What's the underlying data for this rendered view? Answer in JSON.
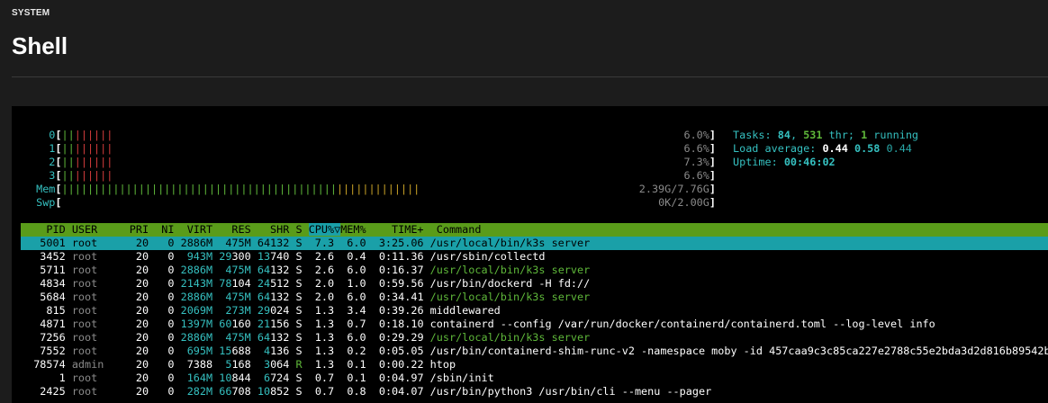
{
  "page": {
    "section_label": "SYSTEM",
    "title": "Shell"
  },
  "meters": [
    {
      "label": "0",
      "bars_green": "||",
      "bars_red": "||||||",
      "value": "6.0%"
    },
    {
      "label": "1",
      "bars_green": "||",
      "bars_red": "||||||",
      "value": "6.6%"
    },
    {
      "label": "2",
      "bars_green": "||",
      "bars_red": "||||||",
      "value": "7.3%"
    },
    {
      "label": "3",
      "bars_green": "||",
      "bars_red": "||||||",
      "value": "6.6%"
    },
    {
      "label": "Mem",
      "bars_green": "|||||||||||||||||||||||||||||||||||||||||||",
      "bars_red": "",
      "bars_yellow": "|||||||||||||",
      "value": "2.39G/7.76G"
    },
    {
      "label": "Swp",
      "bars_green": "",
      "bars_red": "",
      "value": "0K/2.00G"
    }
  ],
  "stats": {
    "tasks_label": "Tasks: ",
    "tasks": "84",
    "sep": ", ",
    "threads": "531",
    "thr_label": " thr; ",
    "running": "1",
    "running_label": " running",
    "load_label": "Load average: ",
    "load1": "0.44",
    "load5": "0.58",
    "load15": "0.44",
    "uptime_label": "Uptime: ",
    "uptime": "00:46:02"
  },
  "columns": {
    "pid": "PID",
    "user": "USER",
    "pri": "PRI",
    "ni": "NI",
    "virt": "VIRT",
    "res": "RES",
    "shr": "SHR",
    "s": "S",
    "cpu": "CPU%",
    "sort_arrow": "▽",
    "mem": "MEM%",
    "time": "TIME+",
    "command": "Command"
  },
  "processes": [
    {
      "pid": "5001",
      "user": "root",
      "pri": "20",
      "ni": "0",
      "virt": "2886M",
      "res": "475M",
      "shr": "64132",
      "s": "S",
      "cpu": "7.3",
      "mem": "6.0",
      "time": "3:25.06",
      "command": "/usr/local/bin/k3s server",
      "selected": true,
      "thread": true
    },
    {
      "pid": "3452",
      "user": "root",
      "pri": "20",
      "ni": "0",
      "virt": "943M",
      "res": "29300",
      "shr": "13740",
      "s": "S",
      "cpu": "2.6",
      "mem": "0.4",
      "time": "0:11.36",
      "command": "/usr/sbin/collectd",
      "thread": false
    },
    {
      "pid": "5711",
      "user": "root",
      "pri": "20",
      "ni": "0",
      "virt": "2886M",
      "res": "475M",
      "shr": "64132",
      "s": "S",
      "cpu": "2.6",
      "mem": "6.0",
      "time": "0:16.37",
      "command": "/usr/local/bin/k3s server",
      "thread": true
    },
    {
      "pid": "4834",
      "user": "root",
      "pri": "20",
      "ni": "0",
      "virt": "2143M",
      "res": "78104",
      "shr": "24512",
      "s": "S",
      "cpu": "2.0",
      "mem": "1.0",
      "time": "0:59.56",
      "command": "/usr/bin/dockerd -H fd://",
      "thread": false
    },
    {
      "pid": "5684",
      "user": "root",
      "pri": "20",
      "ni": "0",
      "virt": "2886M",
      "res": "475M",
      "shr": "64132",
      "s": "S",
      "cpu": "2.0",
      "mem": "6.0",
      "time": "0:34.41",
      "command": "/usr/local/bin/k3s server",
      "thread": true
    },
    {
      "pid": "815",
      "user": "root",
      "pri": "20",
      "ni": "0",
      "virt": "2069M",
      "res": "273M",
      "shr": "29024",
      "s": "S",
      "cpu": "1.3",
      "mem": "3.4",
      "time": "0:39.26",
      "command": "middlewared",
      "thread": false
    },
    {
      "pid": "4871",
      "user": "root",
      "pri": "20",
      "ni": "0",
      "virt": "1397M",
      "res": "60160",
      "shr": "21156",
      "s": "S",
      "cpu": "1.3",
      "mem": "0.7",
      "time": "0:18.10",
      "command": "containerd --config /var/run/docker/containerd/containerd.toml --log-level info",
      "thread": false
    },
    {
      "pid": "7256",
      "user": "root",
      "pri": "20",
      "ni": "0",
      "virt": "2886M",
      "res": "475M",
      "shr": "64132",
      "s": "S",
      "cpu": "1.3",
      "mem": "6.0",
      "time": "0:29.29",
      "command": "/usr/local/bin/k3s server",
      "thread": true
    },
    {
      "pid": "7552",
      "user": "root",
      "pri": "20",
      "ni": "0",
      "virt": "695M",
      "res": "15688",
      "shr": "4136",
      "s": "S",
      "cpu": "1.3",
      "mem": "0.2",
      "time": "0:05.05",
      "command": "/usr/bin/containerd-shim-runc-v2 -namespace moby -id 457caa9c3c85ca227e2788c55e2bda3d2d816b89542b1",
      "thread": false
    },
    {
      "pid": "78574",
      "user": "admin",
      "pri": "20",
      "ni": "0",
      "virt": "7388",
      "res": "5168",
      "shr": "3064",
      "s": "R",
      "cpu": "1.3",
      "mem": "0.1",
      "time": "0:00.22",
      "command": "htop",
      "thread": false
    },
    {
      "pid": "1",
      "user": "root",
      "pri": "20",
      "ni": "0",
      "virt": "164M",
      "res": "10844",
      "shr": "6724",
      "s": "S",
      "cpu": "0.7",
      "mem": "0.1",
      "time": "0:04.97",
      "command": "/sbin/init",
      "thread": false
    },
    {
      "pid": "2425",
      "user": "root",
      "pri": "20",
      "ni": "0",
      "virt": "282M",
      "res": "66708",
      "shr": "10852",
      "s": "S",
      "cpu": "0.7",
      "mem": "0.8",
      "time": "0:04.07",
      "command": "/usr/bin/python3 /usr/bin/cli --menu --pager",
      "thread": false
    }
  ]
}
